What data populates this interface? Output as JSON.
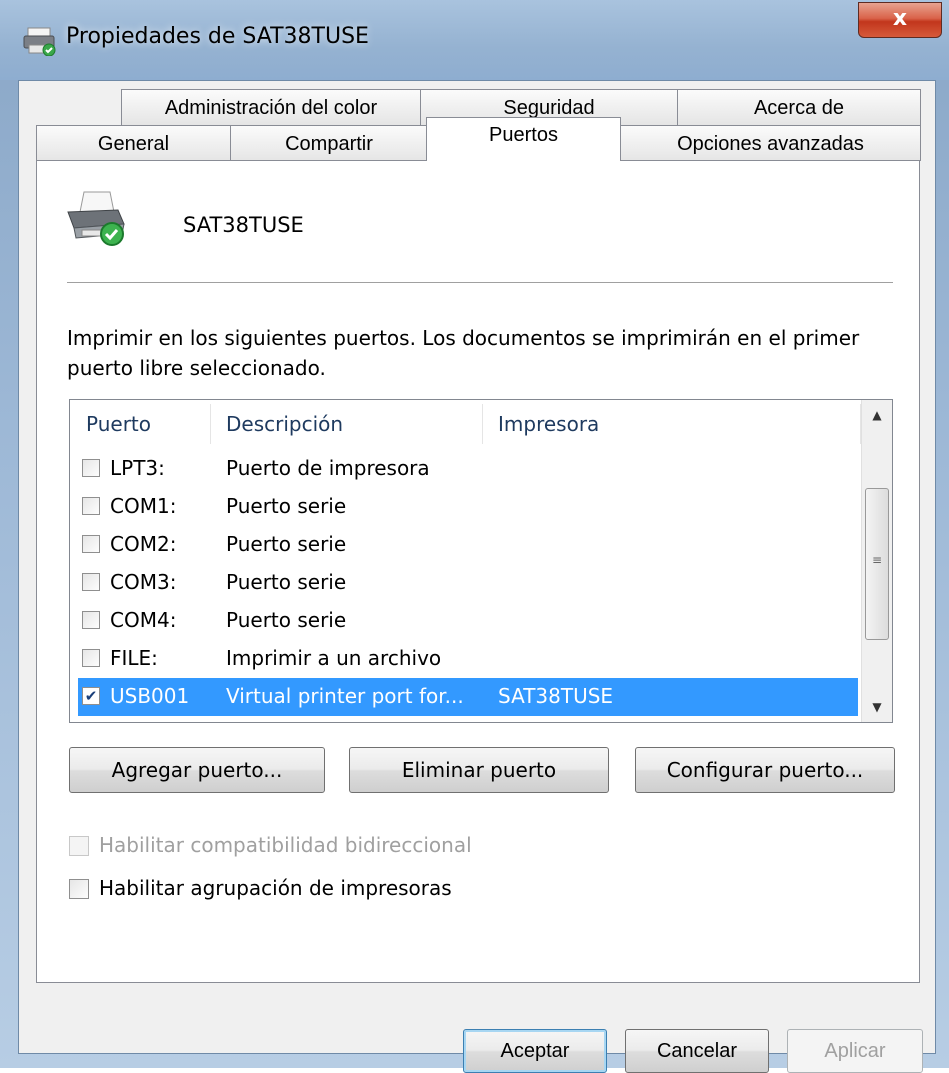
{
  "window": {
    "title": "Propiedades de SAT38TUSE",
    "close_glyph": "x"
  },
  "tabs": {
    "row1": [
      "Administración del color",
      "Seguridad",
      "Acerca de"
    ],
    "row2": [
      "General",
      "Compartir",
      "Puertos",
      "Opciones avanzadas"
    ],
    "active": "Puertos"
  },
  "printer": {
    "name": "SAT38TUSE",
    "icon": "printer-default-icon"
  },
  "description": "Imprimir en los siguientes puertos. Los documentos se imprimirán en el primer puerto libre seleccionado.",
  "ports_table": {
    "columns": [
      "Puerto",
      "Descripción",
      "Impresora"
    ],
    "rows": [
      {
        "checked": false,
        "port": "LPT3:",
        "description": "Puerto de impresora",
        "printer": ""
      },
      {
        "checked": false,
        "port": "COM1:",
        "description": "Puerto serie",
        "printer": ""
      },
      {
        "checked": false,
        "port": "COM2:",
        "description": "Puerto serie",
        "printer": ""
      },
      {
        "checked": false,
        "port": "COM3:",
        "description": "Puerto serie",
        "printer": ""
      },
      {
        "checked": false,
        "port": "COM4:",
        "description": "Puerto serie",
        "printer": ""
      },
      {
        "checked": false,
        "port": "FILE:",
        "description": "Imprimir a un archivo",
        "printer": ""
      },
      {
        "checked": true,
        "port": "USB001",
        "description": "Virtual printer port for...",
        "printer": "SAT38TUSE",
        "selected": true
      }
    ]
  },
  "port_buttons": {
    "add": "Agregar puerto...",
    "delete": "Eliminar puerto",
    "configure": "Configurar puerto..."
  },
  "options": {
    "bidirectional": {
      "label": "Habilitar compatibilidad bidireccional",
      "checked": false,
      "enabled": false
    },
    "pooling": {
      "label": "Habilitar agrupación de impresoras",
      "checked": false,
      "enabled": true
    }
  },
  "dialog_buttons": {
    "ok": "Aceptar",
    "cancel": "Cancelar",
    "apply": "Aplicar"
  },
  "colors": {
    "selection": "#3399ff",
    "close_button": "#c2361c"
  }
}
